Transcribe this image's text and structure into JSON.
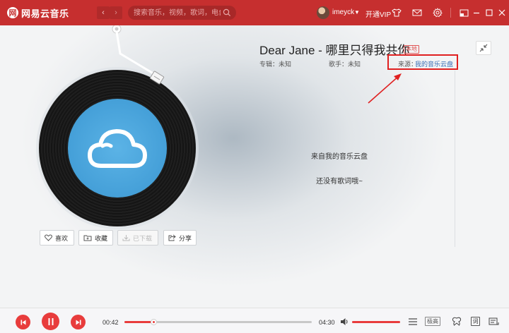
{
  "app": {
    "name": "网易云音乐",
    "logo_glyph": "网",
    "colors": {
      "brand": "#c62f2f",
      "accent": "#e83c3c",
      "link": "#3b6fb6",
      "highlight_box": "#e02020"
    }
  },
  "topbar": {
    "back_glyph": "‹",
    "forward_glyph": "›",
    "search_placeholder": "搜索音乐，视频，歌词，电台",
    "username": "imeyck",
    "vip_label": "开通VIP",
    "icons": [
      "search-icon",
      "chevron-down-icon",
      "shirt-icon",
      "mail-icon",
      "gear-icon",
      "mini-mode-icon",
      "minimize-icon",
      "maximize-icon",
      "close-icon"
    ]
  },
  "song": {
    "title": "Dear Jane - 哪里只得我共你",
    "badge": "本地",
    "album": "专辑：未知",
    "artist": "歌手：未知",
    "source_label": "来源：",
    "source_link": "我的音乐云盘"
  },
  "lyrics": {
    "line1": "来自我的音乐云盘",
    "line2": "还没有歌词哦~"
  },
  "actions": {
    "like": "喜欢",
    "collect": "收藏",
    "download": "已下载",
    "share": "分享"
  },
  "player": {
    "current_time": "00:42",
    "total_time": "04:30",
    "progress_fraction": 0.155,
    "volume_fraction": 1.0,
    "quality_label": "极高",
    "lyric_toggle_label": "词"
  }
}
